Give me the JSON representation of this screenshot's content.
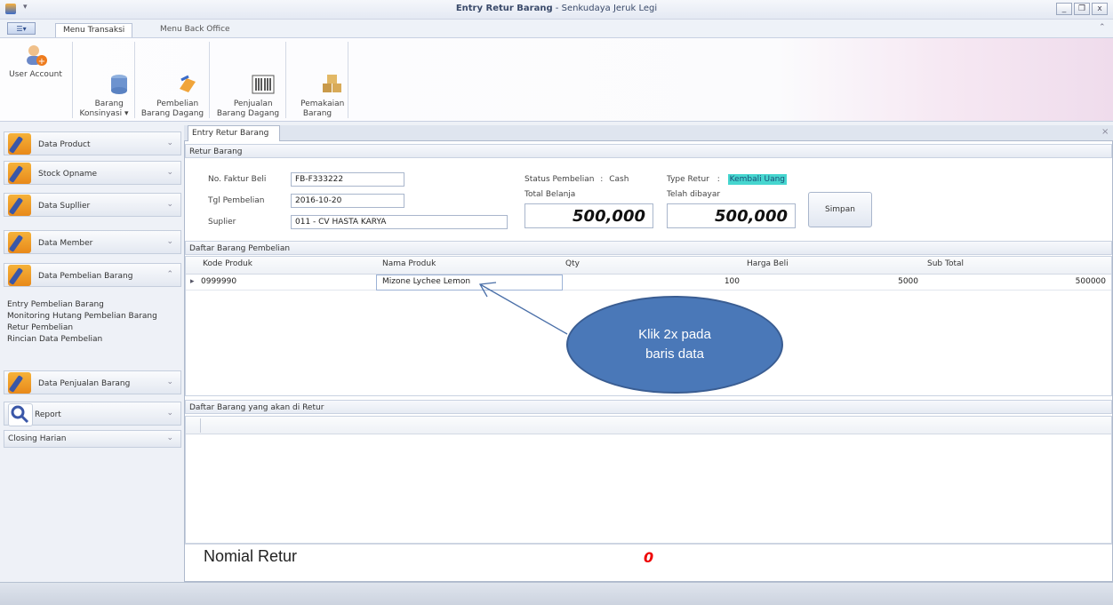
{
  "window": {
    "title_bold": "Entry Retur Barang",
    "title_rest": " - Senkudaya Jeruk Legi",
    "minimize": "_",
    "restore": "❐",
    "close": "x"
  },
  "ribbon_tabs": [
    "Menu Transaksi",
    "Menu Back Office"
  ],
  "ribbon_buttons": [
    {
      "label": "User Account",
      "icon": "user-add-icon"
    },
    {
      "label": "Barang\nKonsinyasi ▾",
      "icon": "database-icon"
    },
    {
      "label": "Pembelian\nBarang Dagang",
      "icon": "purchase-icon"
    },
    {
      "label": "Penjualan\nBarang Dagang",
      "icon": "barcode-icon"
    },
    {
      "label": "Pemakaian\nBarang",
      "icon": "boxes-icon"
    }
  ],
  "leftnav": {
    "items": [
      {
        "label": "Data Product"
      },
      {
        "label": "Stock Opname"
      },
      {
        "label": "Data Supllier"
      },
      {
        "label": "Data Member"
      },
      {
        "label": "Data Pembelian Barang"
      },
      {
        "label": "Data Penjualan Barang"
      },
      {
        "label": "Report"
      }
    ],
    "sublinks": [
      "Entry Pembelian Barang",
      "Monitoring Hutang Pembelian Barang",
      "Retur Pembelian",
      "Rincian Data Pembelian"
    ],
    "closing": "Closing Harian"
  },
  "doc_tab": "Entry Retur Barang",
  "retur": {
    "group_title": "Retur Barang",
    "faktur_label": "No. Faktur Beli",
    "faktur_value": "FB-F333222",
    "tgl_label": "Tgl Pembelian",
    "tgl_value": "2016-10-20",
    "suplier_label": "Suplier",
    "suplier_value": "011 - CV HASTA KARYA",
    "status_label": "Status Pembelian",
    "status_sep": ":",
    "status_value": "Cash",
    "type_label": "Type Retur",
    "type_sep": ":",
    "type_value": "Kembali Uang",
    "total_label": "Total Belanja",
    "total_value": "500,000",
    "dibayar_label": "Telah dibayar",
    "dibayar_value": "500,000",
    "simpan": "Simpan"
  },
  "pembelian_grid": {
    "title": "Daftar Barang Pembelian",
    "columns": [
      "Kode Produk",
      "Nama Produk",
      "Qty",
      "Harga Beli",
      "Sub Total"
    ],
    "rows": [
      {
        "kode": "0999990",
        "nama": "Mizone Lychee Lemon",
        "qty": "100",
        "harga": "5000",
        "subtotal": "500000"
      }
    ]
  },
  "retur_grid": {
    "title": "Daftar Barang yang akan di Retur"
  },
  "callout": {
    "line1": "Klik 2x pada",
    "line2": "baris data"
  },
  "nominal": {
    "label": "Nomial Retur",
    "value": "0"
  }
}
